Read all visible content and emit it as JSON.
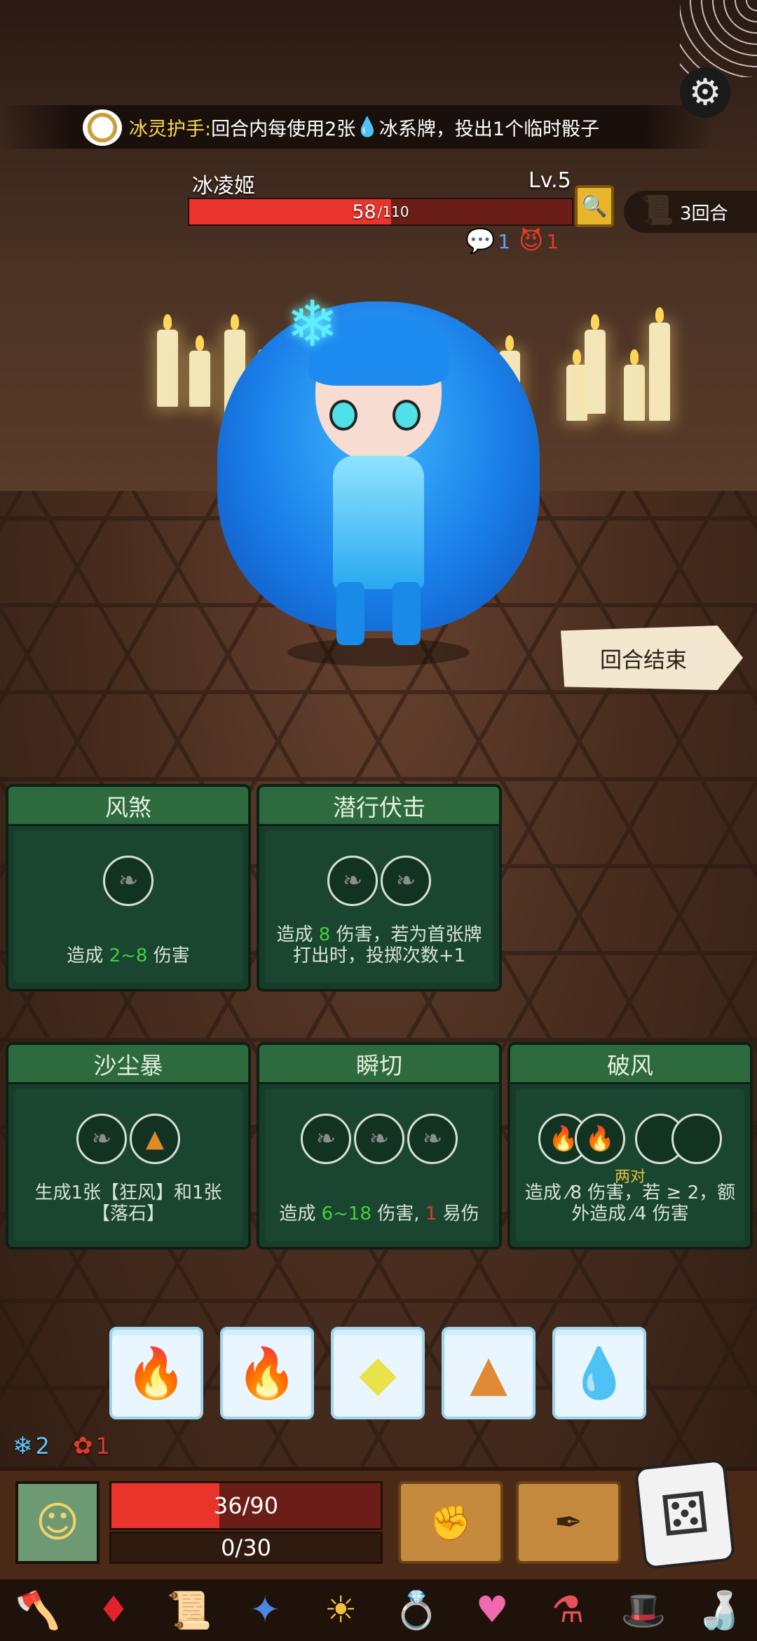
{
  "banner": {
    "title": "冰灵护手:",
    "desc_before": " 回合内每使用2张",
    "desc_after": "冰系牌，投出1个临时骰子",
    "drop_glyph": "💧"
  },
  "enemy": {
    "name": "冰凌姬",
    "level": "Lv.5",
    "hp": "58",
    "hp_max": "/110",
    "hp_fraction": 0.527,
    "intent_talk": "1",
    "intent_attack": "1"
  },
  "turn": {
    "label": "3回合"
  },
  "end_turn": {
    "label": "回合结束"
  },
  "cards": [
    {
      "name": "风煞",
      "slots": [
        "wind"
      ],
      "text_before": "造成 ",
      "text_green": "2~8",
      "text_after": " 伤害"
    },
    {
      "name": "潜行伏击",
      "slots": [
        "wind",
        "wind"
      ],
      "text_before": "造成 ",
      "text_green": "8",
      "text_after": " 伤害，若为首张牌打出时，投掷次数+1"
    },
    {
      "name": "沙尘暴",
      "slots": [
        "wind",
        "rock"
      ],
      "text": "生成1张【狂风】和1张【落石】"
    },
    {
      "name": "瞬切",
      "slots": [
        "wind",
        "wind",
        "wind"
      ],
      "text_before": "造成 ",
      "text_green": "6~18",
      "text_middle": " 伤害, ",
      "text_red": "1",
      "text_after": " 易伤"
    },
    {
      "name": "破风",
      "slots": [
        "fire",
        "fire",
        "empty",
        "empty"
      ],
      "pair_label": "两对",
      "text": "造成 ⁄8 伤害，若 ≥ 2，额外造成 ⁄4 伤害"
    }
  ],
  "dice": [
    "fire",
    "fire",
    "wind",
    "rock",
    "water"
  ],
  "buffs": {
    "frost": "2",
    "bleed": "1"
  },
  "player": {
    "hp_text": "36/90",
    "hp_fraction": 0.4,
    "shield_text": "0/30"
  },
  "colors": {
    "hp_red": "#e8342a",
    "card_green": "#2d6a3e",
    "highlight_yellow": "#ffd84a",
    "water_blue": "#2f8cff"
  },
  "icons": {
    "settings": "gear-icon",
    "inspect": "magnifier-icon",
    "turn": "scroll-icon",
    "dice": "dice-icon",
    "relics": [
      "axe-icon",
      "ruby-icon",
      "scroll-icon",
      "compass-icon",
      "sun-mask-icon",
      "ring-icon",
      "heart-amulet-icon",
      "potion-icon",
      "top-hat-icon",
      "bottle-icon"
    ]
  }
}
